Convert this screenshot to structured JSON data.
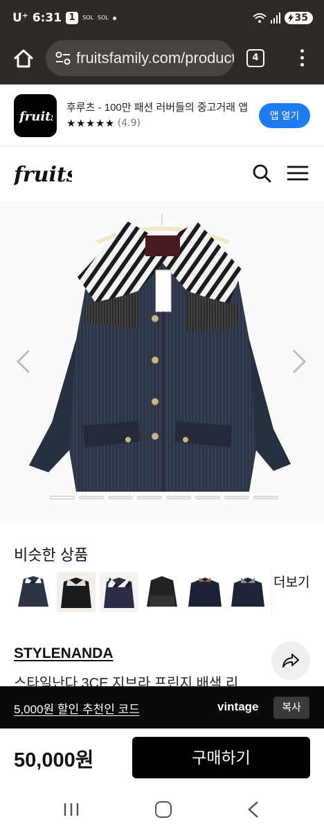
{
  "status_bar": {
    "carrier": "U⁺",
    "time": "6:31",
    "badge": "1",
    "indicator_1": "Super SOL",
    "indicator_2": "SOL Bank",
    "battery": "35"
  },
  "browser": {
    "url": "fruitsfamily.com/product",
    "tab_count": "4"
  },
  "app_banner": {
    "title": "후루츠 - 100만 패션 러버들의 중고거래 앱",
    "stars": "★★★★★",
    "rating": "(4.9)",
    "open_button": "앱 열기"
  },
  "site": {
    "logo_text": "fruits"
  },
  "gallery": {
    "slide_count": 8,
    "active_index": 0
  },
  "similar": {
    "title": "비슷한 상품",
    "more_label": "더보기",
    "items": [
      {
        "name": "thumb-jacket-1"
      },
      {
        "name": "thumb-jacket-2"
      },
      {
        "name": "thumb-jacket-3"
      },
      {
        "name": "thumb-jacket-4"
      },
      {
        "name": "thumb-jacket-5"
      },
      {
        "name": "thumb-jacket-6"
      }
    ]
  },
  "product": {
    "brand": "STYLENANDA",
    "title": "스타일난다 3CE 지브라 프린지 배색 리"
  },
  "coupon": {
    "text": "5,000원 할인 추천인 코드",
    "code": "vintage",
    "copy_label": "복사"
  },
  "purchase": {
    "price": "50,000원",
    "buy_label": "구매하기"
  },
  "colors": {
    "chrome": "#2e2a27",
    "accent_blue": "#1c7cf0",
    "black": "#000000"
  }
}
